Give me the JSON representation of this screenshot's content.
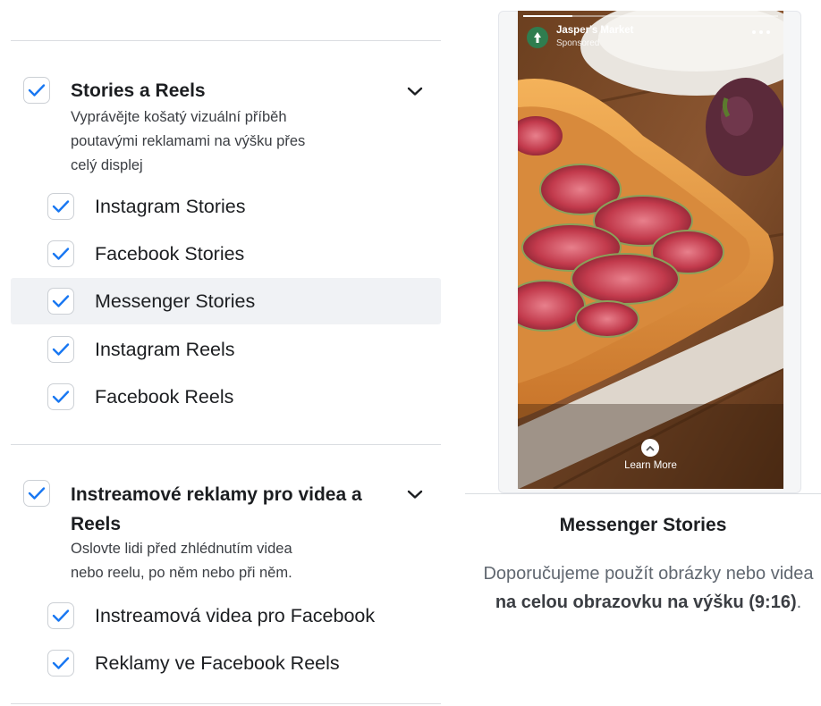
{
  "sections": [
    {
      "title": "Stories a Reels",
      "description": [
        "Vyprávějte košatý vizuální příběh",
        "poutavými reklamami na výšku přes",
        "celý displej"
      ],
      "items": [
        {
          "label": "Instagram Stories"
        },
        {
          "label": "Facebook Stories"
        },
        {
          "label": "Messenger Stories"
        },
        {
          "label": "Instagram Reels"
        },
        {
          "label": "Facebook Reels"
        }
      ]
    },
    {
      "title": [
        "Instreamové reklamy pro videa a",
        "Reels"
      ],
      "description": [
        "Oslovte lidi před zhlédnutím videa",
        "nebo reelu, po něm nebo při něm."
      ],
      "items": [
        {
          "label": "Instreamová videa pro Facebook"
        },
        {
          "label": "Reklamy ve Facebook Reels"
        }
      ]
    }
  ],
  "preview": {
    "advertiser": "Jasper's Market",
    "sponsored": "Sponsored",
    "cta": "Learn More",
    "placement_title": "Messenger Stories",
    "recommendation_prefix": "Doporučujeme použít obrázky nebo videa",
    "recommendation_bold": "na celou obrazovku na výšku (9:16)",
    "recommendation_suffix": "."
  },
  "colors": {
    "accent": "#1877f2",
    "highlight": "#f0f2f5"
  },
  "icons": [
    "checkbox-checked-icon",
    "chevron-down-icon",
    "more-options-icon",
    "chevron-up-icon"
  ]
}
